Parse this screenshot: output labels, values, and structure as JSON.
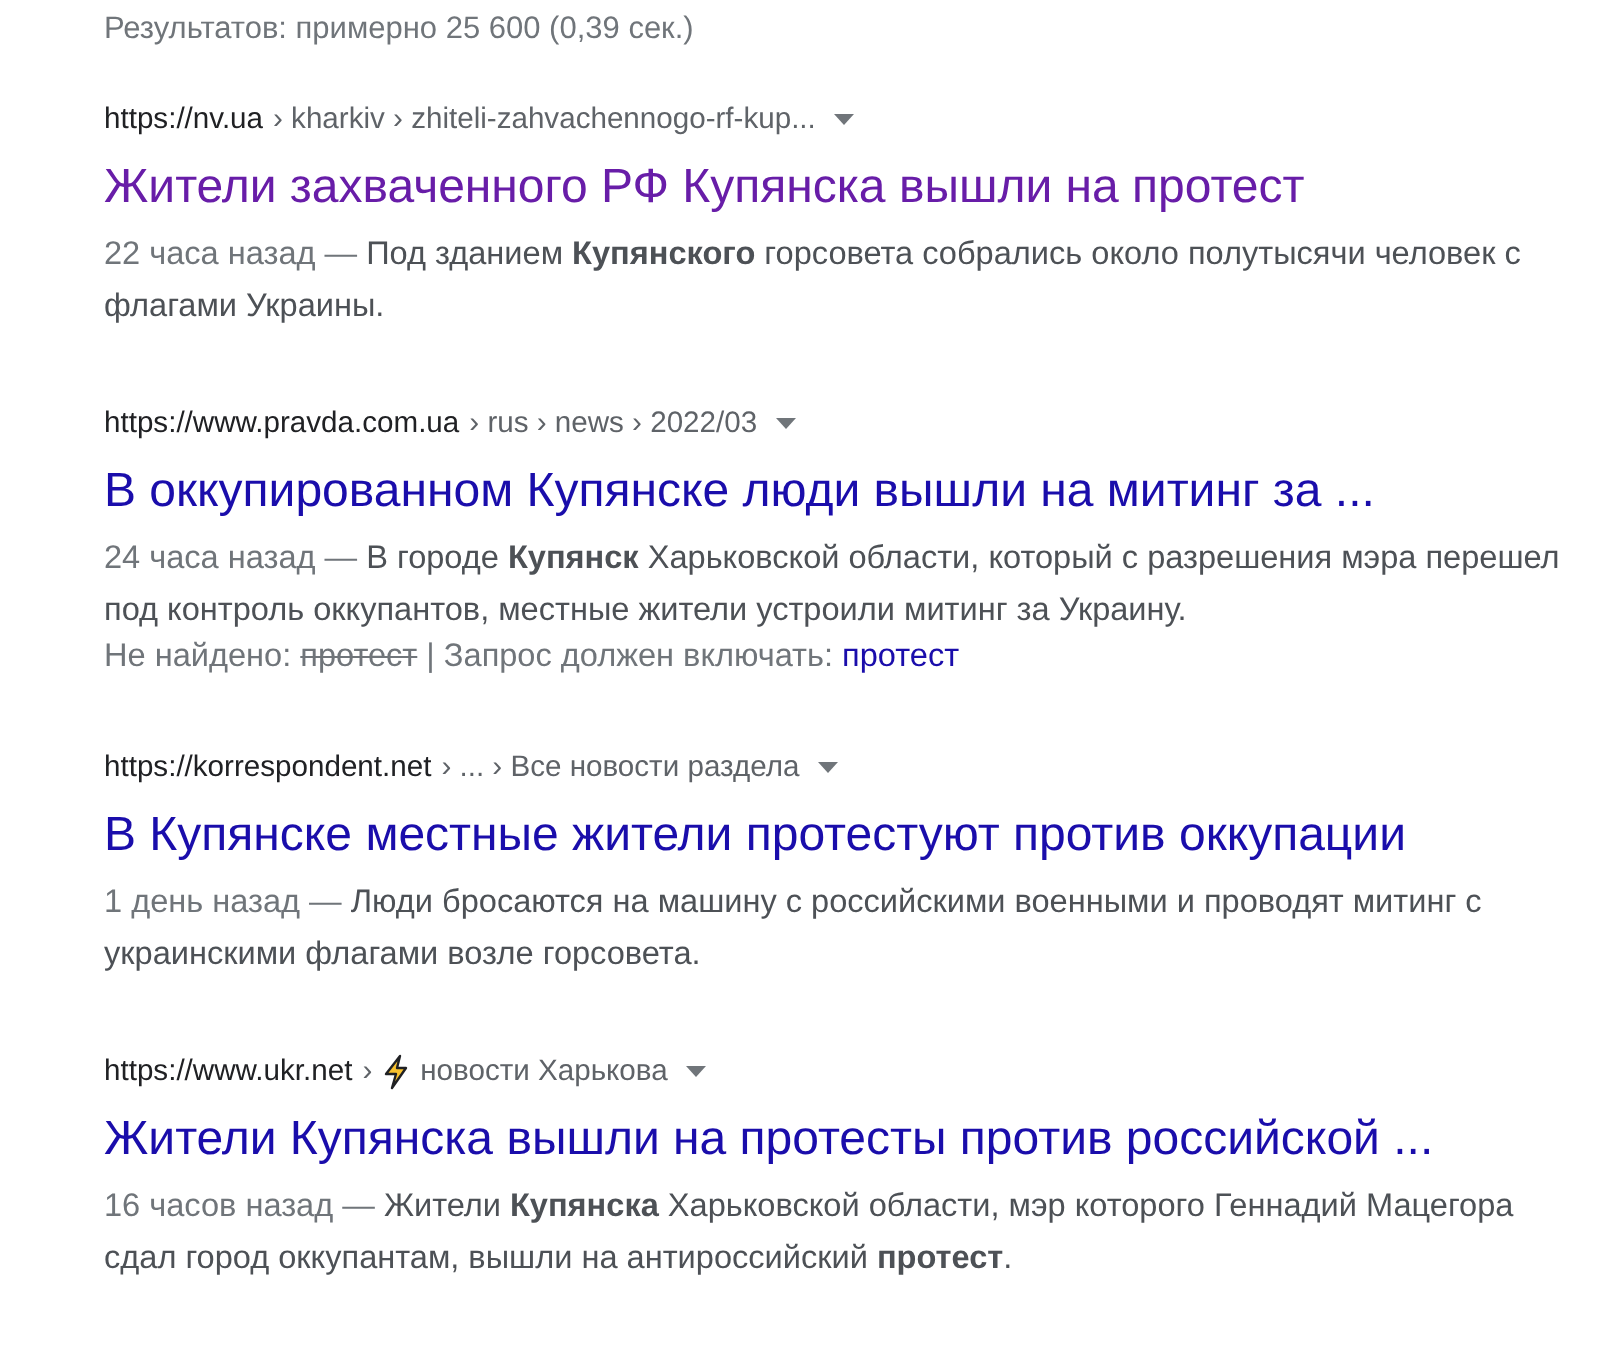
{
  "result_stats": "Результатов: примерно 25 600 (0,39 сек.)",
  "results": [
    {
      "host": "https://nv.ua",
      "path": "› kharkiv › zhiteli-zahvachennogo-rf-kup...",
      "lightning": false,
      "title": "Жители захваченного РФ Купянска вышли на протест",
      "visited": true,
      "date": "22 часа назад —",
      "snippet": "Под зданием **Купянского** горсовета собрались около полутысячи человек с флагами Украины."
    },
    {
      "host": "https://www.pravda.com.ua",
      "path": "› rus › news › 2022/03",
      "lightning": false,
      "title": "В оккупированном Купянске люди вышли на митинг за ...",
      "visited": false,
      "date": "24 часа назад —",
      "snippet": "В городе **Купянск** Харьковской области, который с разрешения мэра перешел под контроль оккупантов, местные жители устроили митинг за Украину.",
      "missing": {
        "label": "Не найдено:",
        "term": "протест",
        "must_include": "| Запрос должен включать:",
        "link": "протест"
      }
    },
    {
      "host": "https://korrespondent.net",
      "path": "› ... › Все новости раздела",
      "lightning": false,
      "title": "В Купянске местные жители протестуют против оккупации",
      "visited": false,
      "date": "1 день назад —",
      "snippet": "Люди бросаются на машину с российскими военными и проводят митинг с украинскими флагами возле горсовета."
    },
    {
      "host": "https://www.ukr.net",
      "path": "›",
      "lightning": true,
      "path_after": "новости Харькова",
      "title": "Жители Купянска вышли на протесты против российской ...",
      "visited": false,
      "date": "16 часов назад —",
      "snippet": "Жители **Купянска** Харьковской области, мэр которого Геннадий Мацегора сдал город оккупантам, вышли на антироссийский **протест**."
    }
  ]
}
